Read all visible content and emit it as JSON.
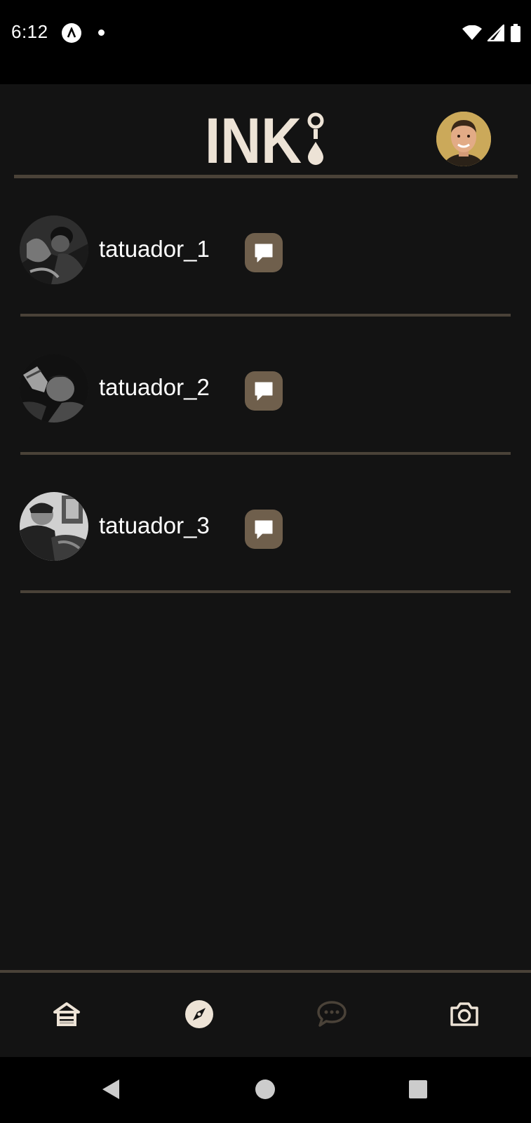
{
  "status_bar": {
    "time": "6:12"
  },
  "header": {
    "logo_text": "INK",
    "logo_icon": "ink-drop-pin-icon",
    "profile_avatar": "avatar"
  },
  "artists": [
    {
      "username": "tatuador_1",
      "action_icon": "chat-bubble-icon"
    },
    {
      "username": "tatuador_2",
      "action_icon": "chat-bubble-icon"
    },
    {
      "username": "tatuador_3",
      "action_icon": "chat-bubble-icon"
    }
  ],
  "bottom_nav": {
    "items": [
      {
        "icon": "home-icon",
        "active": false
      },
      {
        "icon": "compass-icon",
        "active": true
      },
      {
        "icon": "chat-icon",
        "active": false
      },
      {
        "icon": "camera-icon",
        "active": false
      }
    ]
  },
  "colors": {
    "background": "#131313",
    "accent": "#ede3d6",
    "button": "#6f5f4c",
    "divider": "#4a4238",
    "inactive_icon": "#4a4238"
  }
}
